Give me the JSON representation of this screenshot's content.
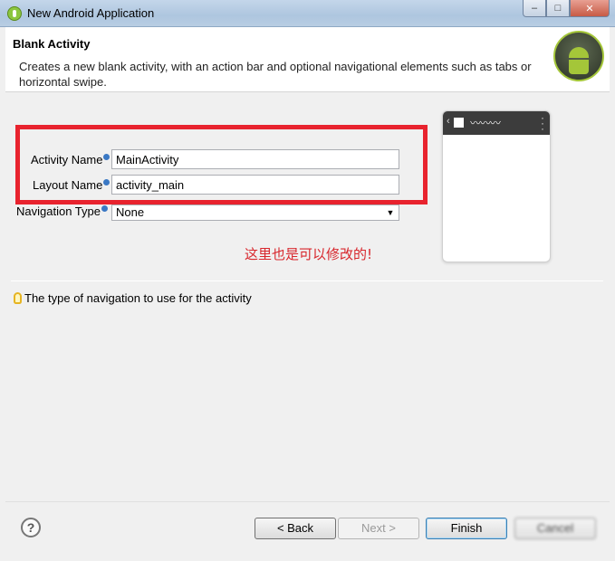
{
  "window": {
    "title": "New Android Application",
    "controls": {
      "minimize": "–",
      "maximize": "□",
      "close": "✕"
    }
  },
  "header": {
    "title": "Blank Activity",
    "description": "Creates a new blank activity, with an action bar and optional navigational elements such as tabs or horizontal swipe."
  },
  "form": {
    "activity_name_label": "Activity Name",
    "activity_name_value": "MainActivity",
    "layout_name_label": "Layout Name",
    "layout_name_value": "activity_main",
    "navigation_type_label": "Navigation Type",
    "navigation_type_value": "None"
  },
  "annotation": "这里也是可以修改的!",
  "hint": "The type of navigation to use for the activity",
  "footer": {
    "help": "?",
    "back": "< Back",
    "next": "Next >",
    "finish": "Finish",
    "cancel": "Cancel"
  },
  "colors": {
    "highlight_box": "#e8232e",
    "annotation_text": "#d8262c",
    "android_green": "#a4c639"
  },
  "icons": [
    "android-app-icon",
    "android-logo-icon",
    "info-icon",
    "lightbulb-icon",
    "help-icon",
    "dropdown-arrow-icon"
  ]
}
